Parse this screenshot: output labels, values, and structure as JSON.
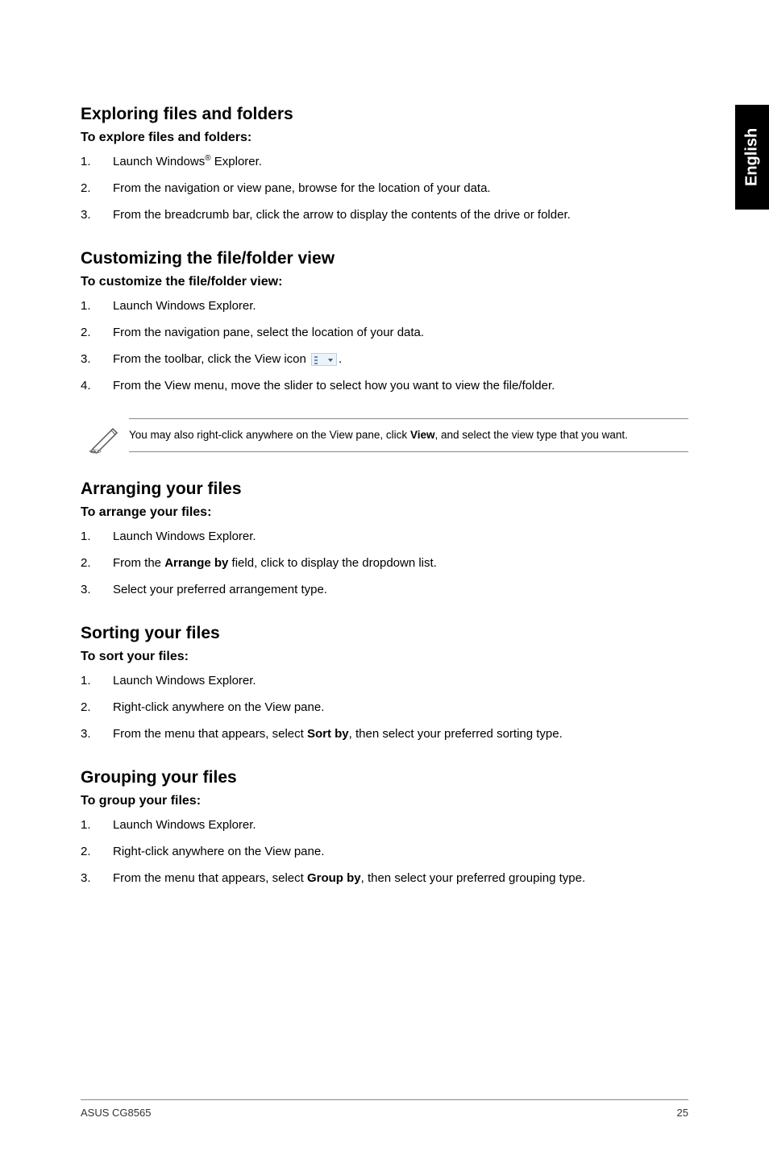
{
  "side_tab": "English",
  "sections": {
    "exploring": {
      "heading": "Exploring files and folders",
      "subheading": "To explore files and folders:",
      "items": [
        {
          "num": "1.",
          "pre": "Launch Windows",
          "sup": "®",
          "post": " Explorer."
        },
        {
          "num": "2.",
          "text": "From the navigation or view pane, browse for the location of your data."
        },
        {
          "num": "3.",
          "text": "From the breadcrumb bar, click the arrow to display the contents of the drive or folder."
        }
      ]
    },
    "customizing": {
      "heading": "Customizing the file/folder view",
      "subheading": "To customize the file/folder view:",
      "items": [
        {
          "num": "1.",
          "text": "Launch Windows Explorer."
        },
        {
          "num": "2.",
          "text": "From the navigation pane, select the location of your data."
        },
        {
          "num": "3.",
          "pre": "From the toolbar, click the View icon ",
          "icon": true,
          "post": "."
        },
        {
          "num": "4.",
          "text": "From the View menu, move the slider to select how you want to view the file/folder."
        }
      ],
      "note_pre": "You may also right-click anywhere on the View pane, click ",
      "note_bold": "View",
      "note_post": ", and select the view type that you want."
    },
    "arranging": {
      "heading": "Arranging your files",
      "subheading": "To arrange your files:",
      "items": [
        {
          "num": "1.",
          "text": "Launch Windows Explorer."
        },
        {
          "num": "2.",
          "pre": "From the ",
          "bold": "Arrange by",
          "post": " field, click to display the dropdown list."
        },
        {
          "num": "3.",
          "text": "Select your preferred arrangement type."
        }
      ]
    },
    "sorting": {
      "heading": "Sorting your files",
      "subheading": "To sort your files:",
      "items": [
        {
          "num": "1.",
          "text": "Launch Windows Explorer."
        },
        {
          "num": "2.",
          "text": "Right-click anywhere on the View pane."
        },
        {
          "num": "3.",
          "pre": "From the menu that appears, select ",
          "bold": "Sort by",
          "post": ", then select your preferred sorting type."
        }
      ]
    },
    "grouping": {
      "heading": "Grouping your files",
      "subheading": "To group your files:",
      "items": [
        {
          "num": "1.",
          "text": "Launch Windows Explorer."
        },
        {
          "num": "2.",
          "text": "Right-click anywhere on the View pane."
        },
        {
          "num": "3.",
          "pre": "From the menu that appears, select ",
          "bold": "Group by",
          "post": ", then select your preferred grouping type."
        }
      ]
    }
  },
  "footer": {
    "left": "ASUS CG8565",
    "right": "25"
  }
}
